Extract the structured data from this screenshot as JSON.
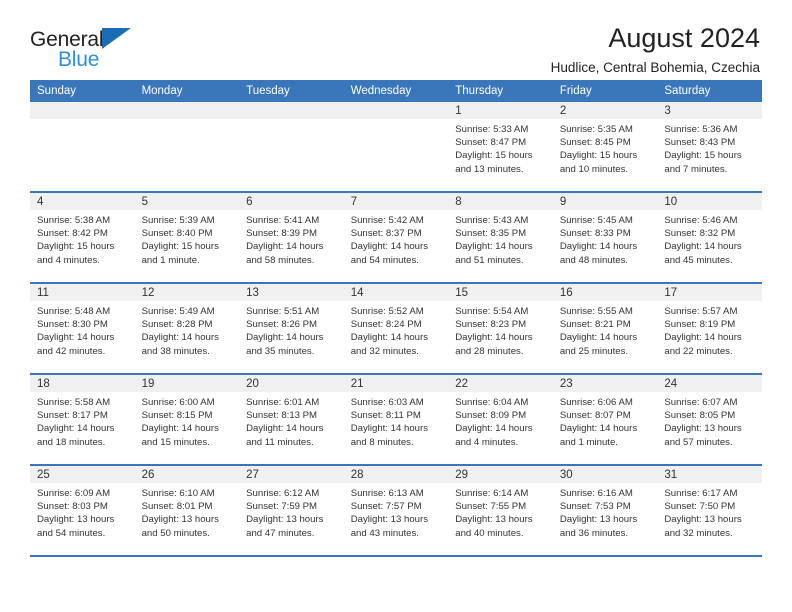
{
  "brand": {
    "name_top": "General",
    "name_bottom": "Blue",
    "triangle_color": "#1b6cb3",
    "blue_text_color": "#2f8fdc"
  },
  "header": {
    "title": "August 2024",
    "subtitle": "Hudlice, Central Bohemia, Czechia"
  },
  "theme": {
    "header_bg": "#3a76ba",
    "header_text": "#ffffff",
    "daynum_bg": "#f0f0f0",
    "row_divider": "#3a76ba",
    "body_text": "#333333"
  },
  "weekday_headers": [
    "Sunday",
    "Monday",
    "Tuesday",
    "Wednesday",
    "Thursday",
    "Friday",
    "Saturday"
  ],
  "weeks": [
    [
      {
        "day": "",
        "empty": true
      },
      {
        "day": "",
        "empty": true
      },
      {
        "day": "",
        "empty": true
      },
      {
        "day": "",
        "empty": true
      },
      {
        "day": "1",
        "sunrise": "Sunrise: 5:33 AM",
        "sunset": "Sunset: 8:47 PM",
        "daylight": "Daylight: 15 hours and 13 minutes."
      },
      {
        "day": "2",
        "sunrise": "Sunrise: 5:35 AM",
        "sunset": "Sunset: 8:45 PM",
        "daylight": "Daylight: 15 hours and 10 minutes."
      },
      {
        "day": "3",
        "sunrise": "Sunrise: 5:36 AM",
        "sunset": "Sunset: 8:43 PM",
        "daylight": "Daylight: 15 hours and 7 minutes."
      }
    ],
    [
      {
        "day": "4",
        "sunrise": "Sunrise: 5:38 AM",
        "sunset": "Sunset: 8:42 PM",
        "daylight": "Daylight: 15 hours and 4 minutes."
      },
      {
        "day": "5",
        "sunrise": "Sunrise: 5:39 AM",
        "sunset": "Sunset: 8:40 PM",
        "daylight": "Daylight: 15 hours and 1 minute."
      },
      {
        "day": "6",
        "sunrise": "Sunrise: 5:41 AM",
        "sunset": "Sunset: 8:39 PM",
        "daylight": "Daylight: 14 hours and 58 minutes."
      },
      {
        "day": "7",
        "sunrise": "Sunrise: 5:42 AM",
        "sunset": "Sunset: 8:37 PM",
        "daylight": "Daylight: 14 hours and 54 minutes."
      },
      {
        "day": "8",
        "sunrise": "Sunrise: 5:43 AM",
        "sunset": "Sunset: 8:35 PM",
        "daylight": "Daylight: 14 hours and 51 minutes."
      },
      {
        "day": "9",
        "sunrise": "Sunrise: 5:45 AM",
        "sunset": "Sunset: 8:33 PM",
        "daylight": "Daylight: 14 hours and 48 minutes."
      },
      {
        "day": "10",
        "sunrise": "Sunrise: 5:46 AM",
        "sunset": "Sunset: 8:32 PM",
        "daylight": "Daylight: 14 hours and 45 minutes."
      }
    ],
    [
      {
        "day": "11",
        "sunrise": "Sunrise: 5:48 AM",
        "sunset": "Sunset: 8:30 PM",
        "daylight": "Daylight: 14 hours and 42 minutes."
      },
      {
        "day": "12",
        "sunrise": "Sunrise: 5:49 AM",
        "sunset": "Sunset: 8:28 PM",
        "daylight": "Daylight: 14 hours and 38 minutes."
      },
      {
        "day": "13",
        "sunrise": "Sunrise: 5:51 AM",
        "sunset": "Sunset: 8:26 PM",
        "daylight": "Daylight: 14 hours and 35 minutes."
      },
      {
        "day": "14",
        "sunrise": "Sunrise: 5:52 AM",
        "sunset": "Sunset: 8:24 PM",
        "daylight": "Daylight: 14 hours and 32 minutes."
      },
      {
        "day": "15",
        "sunrise": "Sunrise: 5:54 AM",
        "sunset": "Sunset: 8:23 PM",
        "daylight": "Daylight: 14 hours and 28 minutes."
      },
      {
        "day": "16",
        "sunrise": "Sunrise: 5:55 AM",
        "sunset": "Sunset: 8:21 PM",
        "daylight": "Daylight: 14 hours and 25 minutes."
      },
      {
        "day": "17",
        "sunrise": "Sunrise: 5:57 AM",
        "sunset": "Sunset: 8:19 PM",
        "daylight": "Daylight: 14 hours and 22 minutes."
      }
    ],
    [
      {
        "day": "18",
        "sunrise": "Sunrise: 5:58 AM",
        "sunset": "Sunset: 8:17 PM",
        "daylight": "Daylight: 14 hours and 18 minutes."
      },
      {
        "day": "19",
        "sunrise": "Sunrise: 6:00 AM",
        "sunset": "Sunset: 8:15 PM",
        "daylight": "Daylight: 14 hours and 15 minutes."
      },
      {
        "day": "20",
        "sunrise": "Sunrise: 6:01 AM",
        "sunset": "Sunset: 8:13 PM",
        "daylight": "Daylight: 14 hours and 11 minutes."
      },
      {
        "day": "21",
        "sunrise": "Sunrise: 6:03 AM",
        "sunset": "Sunset: 8:11 PM",
        "daylight": "Daylight: 14 hours and 8 minutes."
      },
      {
        "day": "22",
        "sunrise": "Sunrise: 6:04 AM",
        "sunset": "Sunset: 8:09 PM",
        "daylight": "Daylight: 14 hours and 4 minutes."
      },
      {
        "day": "23",
        "sunrise": "Sunrise: 6:06 AM",
        "sunset": "Sunset: 8:07 PM",
        "daylight": "Daylight: 14 hours and 1 minute."
      },
      {
        "day": "24",
        "sunrise": "Sunrise: 6:07 AM",
        "sunset": "Sunset: 8:05 PM",
        "daylight": "Daylight: 13 hours and 57 minutes."
      }
    ],
    [
      {
        "day": "25",
        "sunrise": "Sunrise: 6:09 AM",
        "sunset": "Sunset: 8:03 PM",
        "daylight": "Daylight: 13 hours and 54 minutes."
      },
      {
        "day": "26",
        "sunrise": "Sunrise: 6:10 AM",
        "sunset": "Sunset: 8:01 PM",
        "daylight": "Daylight: 13 hours and 50 minutes."
      },
      {
        "day": "27",
        "sunrise": "Sunrise: 6:12 AM",
        "sunset": "Sunset: 7:59 PM",
        "daylight": "Daylight: 13 hours and 47 minutes."
      },
      {
        "day": "28",
        "sunrise": "Sunrise: 6:13 AM",
        "sunset": "Sunset: 7:57 PM",
        "daylight": "Daylight: 13 hours and 43 minutes."
      },
      {
        "day": "29",
        "sunrise": "Sunrise: 6:14 AM",
        "sunset": "Sunset: 7:55 PM",
        "daylight": "Daylight: 13 hours and 40 minutes."
      },
      {
        "day": "30",
        "sunrise": "Sunrise: 6:16 AM",
        "sunset": "Sunset: 7:53 PM",
        "daylight": "Daylight: 13 hours and 36 minutes."
      },
      {
        "day": "31",
        "sunrise": "Sunrise: 6:17 AM",
        "sunset": "Sunset: 7:50 PM",
        "daylight": "Daylight: 13 hours and 32 minutes."
      }
    ]
  ]
}
